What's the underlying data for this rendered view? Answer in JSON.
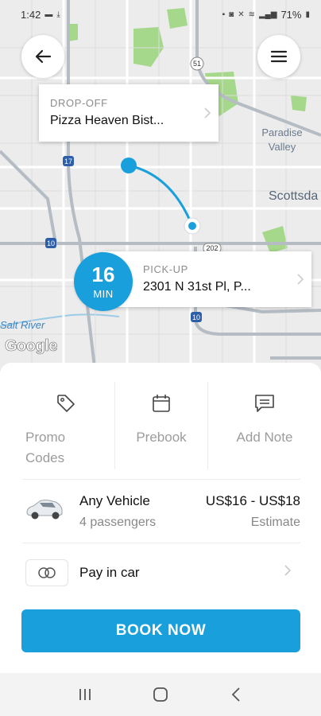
{
  "status_bar": {
    "time": "1:42",
    "battery": "71%",
    "icons": [
      "message-icon",
      "download-icon",
      "lock-icon",
      "camera-icon",
      "mute-icon",
      "wifi-icon",
      "signal-icon",
      "battery-icon"
    ]
  },
  "map": {
    "labels": {
      "paradise": "Paradise",
      "valley": "Valley",
      "scottsdale": "Scottsda",
      "salt_river": "Salt River"
    },
    "shields": [
      "51",
      "17",
      "10",
      "202",
      "10"
    ],
    "attribution": "Google",
    "route_color": "#1a9fdd"
  },
  "header": {
    "back_icon": "arrow-left-icon",
    "menu_icon": "hamburger-menu-icon"
  },
  "dropoff": {
    "label": "DROP-OFF",
    "value": "Pizza Heaven Bist..."
  },
  "pickup": {
    "label": "PICK-UP",
    "value": "2301 N 31st Pl, P...",
    "eta_number": "16",
    "eta_unit": "MIN"
  },
  "actions": [
    {
      "label": "Promo Codes",
      "icon": "tag-icon"
    },
    {
      "label": "Prebook",
      "icon": "calendar-icon"
    },
    {
      "label": "Add Note",
      "icon": "message-square-icon"
    }
  ],
  "vehicle": {
    "name": "Any Vehicle",
    "capacity": "4 passengers",
    "price": "US$16 - US$18",
    "price_note": "Estimate",
    "icon": "car-icon"
  },
  "payment": {
    "label": "Pay in car",
    "icon": "cash-icon"
  },
  "book_button": "BOOK NOW",
  "colors": {
    "accent": "#1a9fdd",
    "map_bg": "#ececec",
    "park_green": "#a5d88a"
  },
  "nav_bar": [
    "recent-apps-icon",
    "home-icon",
    "back-icon"
  ]
}
